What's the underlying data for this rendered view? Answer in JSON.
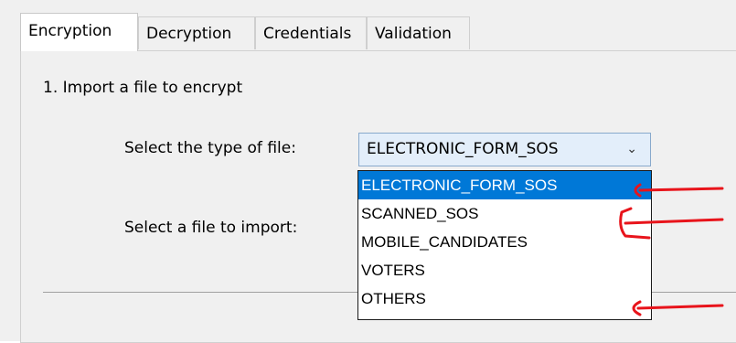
{
  "tabs": [
    {
      "label": "Encryption",
      "active": true
    },
    {
      "label": "Decryption",
      "active": false
    },
    {
      "label": "Credentials",
      "active": false
    },
    {
      "label": "Validation",
      "active": false
    }
  ],
  "section": {
    "title": "1. Import a file to encrypt"
  },
  "file_type": {
    "label": "Select the type of file:",
    "selected": "ELECTRONIC_FORM_SOS",
    "options": [
      "ELECTRONIC_FORM_SOS",
      "SCANNED_SOS",
      "MOBILE_CANDIDATES",
      "VOTERS",
      "OTHERS"
    ]
  },
  "import": {
    "label": "Select a file to import:"
  },
  "colors": {
    "accent": "#0078d7",
    "annotation": "#e8141b"
  }
}
